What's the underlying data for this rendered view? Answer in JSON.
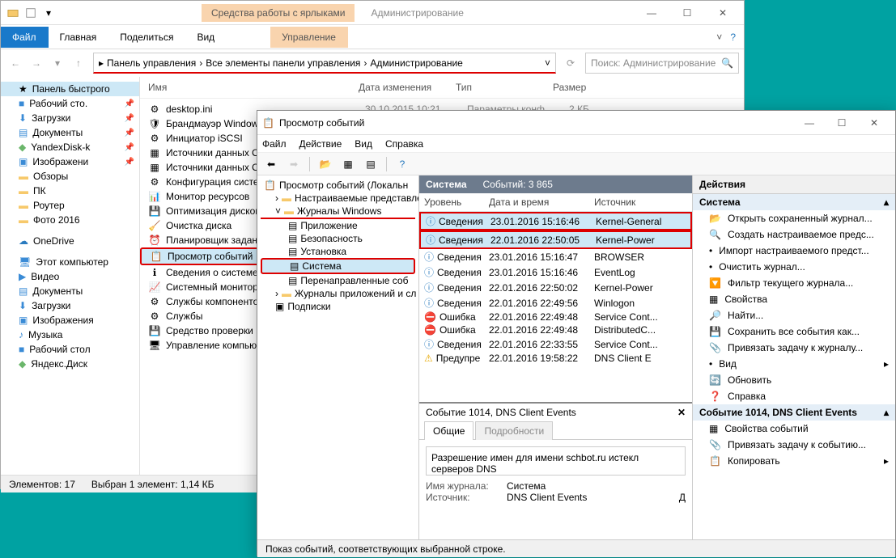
{
  "explorer": {
    "ribbon_context": "Средства работы с ярлыками",
    "title": "Администрирование",
    "tabs": {
      "file": "Файл",
      "home": "Главная",
      "share": "Поделиться",
      "view": "Вид",
      "manage": "Управление"
    },
    "breadcrumb": [
      "Панель управления",
      "Все элементы панели управления",
      "Администрирование"
    ],
    "search_placeholder": "Поиск: Администрирование",
    "columns": [
      "Имя",
      "Дата изменения",
      "Тип",
      "Размер"
    ],
    "sidebar": {
      "quick_access": "Панель быстрого",
      "items": [
        "Рабочий сто.",
        "Загрузки",
        "Документы",
        "YandexDisk-k",
        "Изображени",
        "Обзоры",
        "ПК",
        "Роутер",
        "Фото 2016"
      ],
      "onedrive": "OneDrive",
      "thispc": "Этот компьютер",
      "pc_items": [
        "Видео",
        "Документы",
        "Загрузки",
        "Изображения",
        "Музыка",
        "Рабочий стол",
        "Яндекс.Диск"
      ]
    },
    "files": [
      "desktop.ini",
      "Брандмауэр Window",
      "Инициатор iSCSI",
      "Источники данных O",
      "Источники данных O",
      "Конфигурация систе",
      "Монитор ресурсов",
      "Оптимизация дисков",
      "Очистка диска",
      "Планировщик задани",
      "Просмотр событий",
      "Сведения о системе",
      "Системный монитор",
      "Службы компоненто",
      "Службы",
      "Средство проверки п",
      "Управление компью"
    ],
    "file_date": "30.10.2015 10:21",
    "file_type": "Параметры конф",
    "file_size": "2 КБ",
    "status_count": "Элементов: 17",
    "status_sel": "Выбран 1 элемент: 1,14 КБ"
  },
  "eventviewer": {
    "title": "Просмотр событий",
    "menu": [
      "Файл",
      "Действие",
      "Вид",
      "Справка"
    ],
    "tree": {
      "root": "Просмотр событий (Локальн",
      "custom": "Настраиваемые представле",
      "winlogs": "Журналы Windows",
      "logs": [
        "Приложение",
        "Безопасность",
        "Установка",
        "Система",
        "Перенаправленные соб"
      ],
      "applogs": "Журналы приложений и сл",
      "subs": "Подписки"
    },
    "center": {
      "header_title": "Система",
      "header_count": "Событий: 3 865",
      "columns": [
        "Уровень",
        "Дата и время",
        "Источник"
      ],
      "rows": [
        {
          "lvl": "info",
          "level": "Сведения",
          "date": "23.01.2016 15:16:46",
          "src": "Kernel-General"
        },
        {
          "lvl": "info",
          "level": "Сведения",
          "date": "22.01.2016 22:50:05",
          "src": "Kernel-Power"
        },
        {
          "lvl": "info",
          "level": "Сведения",
          "date": "23.01.2016 15:16:47",
          "src": "BROWSER"
        },
        {
          "lvl": "info",
          "level": "Сведения",
          "date": "23.01.2016 15:16:46",
          "src": "EventLog"
        },
        {
          "lvl": "info",
          "level": "Сведения",
          "date": "22.01.2016 22:50:02",
          "src": "Kernel-Power"
        },
        {
          "lvl": "info",
          "level": "Сведения",
          "date": "22.01.2016 22:49:56",
          "src": "Winlogon"
        },
        {
          "lvl": "err",
          "level": "Ошибка",
          "date": "22.01.2016 22:49:48",
          "src": "Service Cont..."
        },
        {
          "lvl": "err",
          "level": "Ошибка",
          "date": "22.01.2016 22:49:48",
          "src": "DistributedC..."
        },
        {
          "lvl": "info",
          "level": "Сведения",
          "date": "22.01.2016 22:33:55",
          "src": "Service Cont..."
        },
        {
          "lvl": "warn",
          "level": "Предупре",
          "date": "22.01.2016 19:58:22",
          "src": "DNS Client E"
        }
      ]
    },
    "detail": {
      "header": "Событие 1014, DNS Client Events",
      "tab_general": "Общие",
      "tab_details": "Подробности",
      "message": "Разрешение имен для имени schbot.ru истекл серверов DNS",
      "log_name_k": "Имя журнала:",
      "log_name_v": "Система",
      "source_k": "Источник:",
      "source_v": "DNS Client Events",
      "date_k": "Д"
    },
    "actions": {
      "header": "Действия",
      "section1": "Система",
      "items1": [
        "Открыть сохраненный журнал...",
        "Создать настраиваемое предс...",
        "Импорт настраиваемого предст...",
        "Очистить журнал...",
        "Фильтр текущего журнала...",
        "Свойства",
        "Найти...",
        "Сохранить все события как...",
        "Привязать задачу к журналу...",
        "Вид",
        "Обновить",
        "Справка"
      ],
      "section2": "Событие 1014, DNS Client Events",
      "items2": [
        "Свойства событий",
        "Привязать задачу к событию...",
        "Копировать"
      ]
    },
    "status": "Показ событий, соответствующих выбранной строке."
  }
}
